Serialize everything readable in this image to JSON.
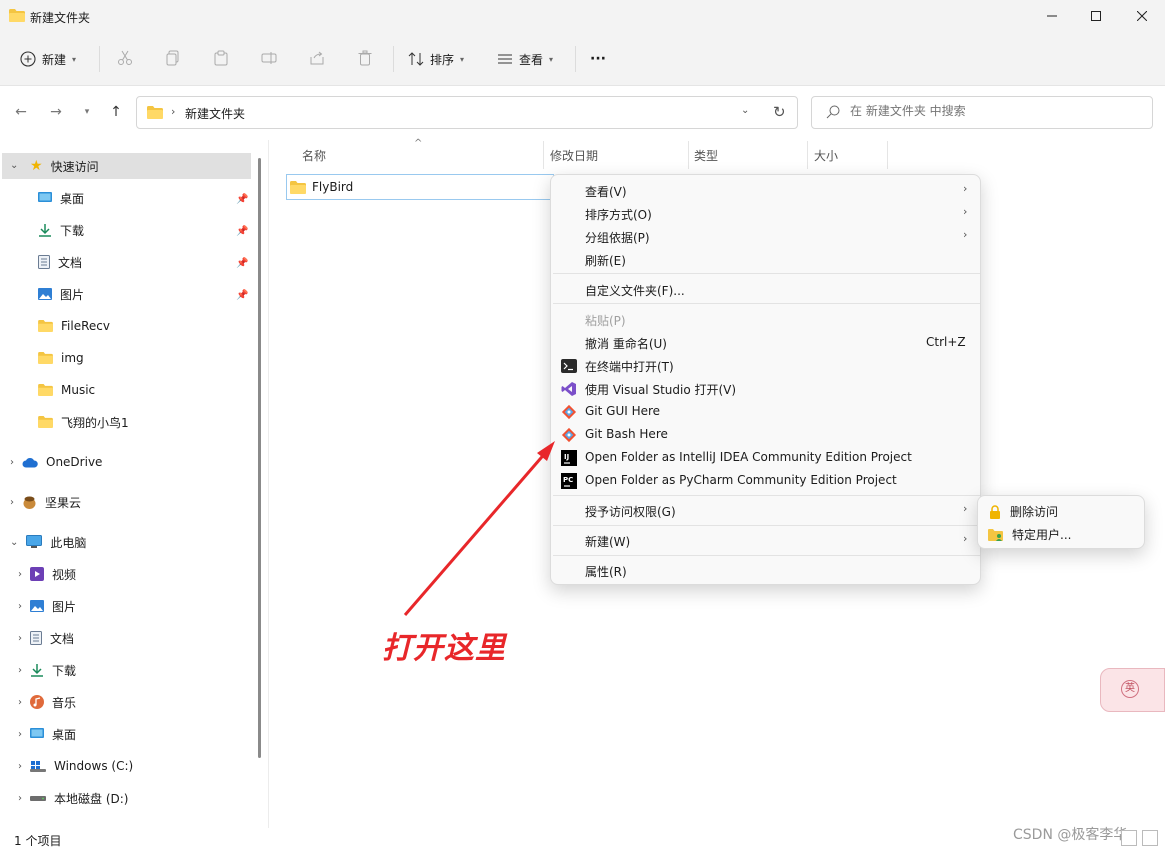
{
  "window": {
    "title": "新建文件夹"
  },
  "toolbar": {
    "new_label": "新建",
    "sort_label": "排序",
    "view_label": "查看",
    "more_label": "···"
  },
  "address": {
    "path": "新建文件夹"
  },
  "search": {
    "placeholder": "在 新建文件夹 中搜索"
  },
  "sidebar": {
    "quick_access": "快速访问",
    "quick_items": [
      {
        "label": "桌面",
        "icon": "desktop-icon",
        "pinned": true
      },
      {
        "label": "下载",
        "icon": "download-icon",
        "pinned": true
      },
      {
        "label": "文档",
        "icon": "document-icon",
        "pinned": true
      },
      {
        "label": "图片",
        "icon": "picture-icon",
        "pinned": true
      },
      {
        "label": "FileRecv",
        "icon": "folder-icon",
        "pinned": false
      },
      {
        "label": "img",
        "icon": "folder-icon",
        "pinned": false
      },
      {
        "label": "Music",
        "icon": "folder-icon",
        "pinned": false
      },
      {
        "label": "飞翔的小鸟1",
        "icon": "folder-icon",
        "pinned": false
      }
    ],
    "onedrive": "OneDrive",
    "nutstore": "坚果云",
    "this_pc": "此电脑",
    "pc_items": [
      {
        "label": "视频",
        "icon": "video-icon"
      },
      {
        "label": "图片",
        "icon": "picture-icon"
      },
      {
        "label": "文档",
        "icon": "document-icon"
      },
      {
        "label": "下载",
        "icon": "download-icon"
      },
      {
        "label": "音乐",
        "icon": "music-icon"
      },
      {
        "label": "桌面",
        "icon": "desktop-icon"
      },
      {
        "label": "Windows (C:)",
        "icon": "drive-icon"
      },
      {
        "label": "本地磁盘 (D:)",
        "icon": "drive-icon"
      }
    ]
  },
  "columns": {
    "name": "名称",
    "date": "修改日期",
    "type": "类型",
    "size": "大小"
  },
  "files": [
    {
      "name": "FlyBird",
      "icon": "folder-icon"
    }
  ],
  "context_menu": {
    "view": "查看(V)",
    "sort": "排序方式(O)",
    "group": "分组依据(P)",
    "refresh": "刷新(E)",
    "customize": "自定义文件夹(F)...",
    "paste": "粘贴(P)",
    "undo_rename": "撤消 重命名(U)",
    "undo_shortcut": "Ctrl+Z",
    "open_terminal": "在终端中打开(T)",
    "open_vs": "使用 Visual Studio 打开(V)",
    "git_gui": "Git GUI Here",
    "git_bash": "Git Bash Here",
    "intellij": "Open Folder as IntelliJ IDEA Community Edition Project",
    "pycharm": "Open Folder as PyCharm Community Edition Project",
    "grant_access": "授予访问权限(G)",
    "new": "新建(W)",
    "properties": "属性(R)"
  },
  "submenu": {
    "remove_access": "删除访问",
    "specific_users": "特定用户..."
  },
  "annotation": "打开这里",
  "status": {
    "item_count": "1 个项目"
  },
  "watermark": "CSDN @极客李华",
  "sticker_char": "英",
  "colors": {
    "accent": "#0067c0",
    "folder": "#f4c542",
    "annotation": "#e8272a",
    "selected": "#e0e0e0"
  }
}
